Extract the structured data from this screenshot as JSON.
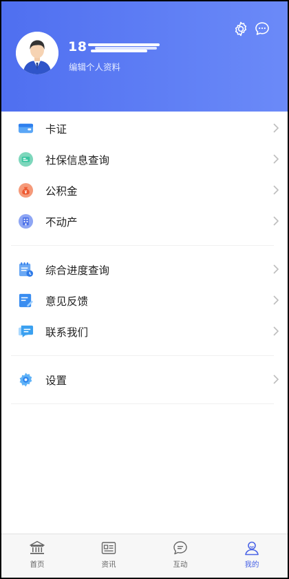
{
  "profile": {
    "phone_prefix": "18",
    "edit_label": "编辑个人资料"
  },
  "header_icons": [
    "gear-icon",
    "message-icon"
  ],
  "menu_groups": [
    [
      {
        "label": "卡证",
        "icon": "card-icon",
        "color": "#3d8bf3"
      },
      {
        "label": "社保信息查询",
        "icon": "social-security-icon",
        "color": "#39c6a0"
      },
      {
        "label": "公积金",
        "icon": "money-bag-icon",
        "color": "#f0653f"
      },
      {
        "label": "不动产",
        "icon": "building-icon",
        "color": "#4b70e8"
      }
    ],
    [
      {
        "label": "综合进度查询",
        "icon": "progress-query-icon",
        "color": "#4a90f0"
      },
      {
        "label": "意见反馈",
        "icon": "feedback-icon",
        "color": "#3a8df0"
      },
      {
        "label": "联系我们",
        "icon": "contact-icon",
        "color": "#3aa0f0"
      }
    ],
    [
      {
        "label": "设置",
        "icon": "settings-icon",
        "color": "#3d9df3"
      }
    ]
  ],
  "tabs": [
    {
      "label": "首页",
      "icon": "bank-icon",
      "active": false
    },
    {
      "label": "资讯",
      "icon": "news-icon",
      "active": false
    },
    {
      "label": "互动",
      "icon": "chat-icon",
      "active": false
    },
    {
      "label": "我的",
      "icon": "user-icon",
      "active": true
    }
  ],
  "colors": {
    "header_start": "#4f6ff0",
    "header_end": "#6b8af8",
    "tab_active": "#4a64e6",
    "tab_inactive": "#666666"
  }
}
